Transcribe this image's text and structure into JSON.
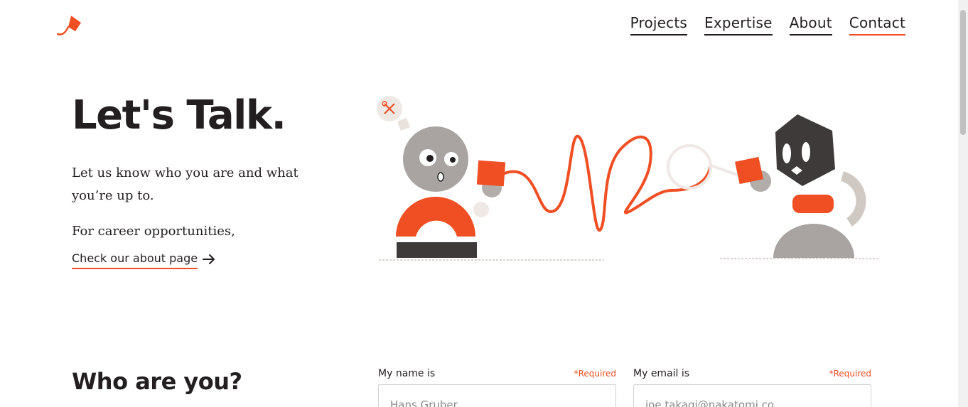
{
  "brand": {
    "logo_icon": "kite-logo-icon",
    "accent_color": "#f04e23"
  },
  "nav": [
    {
      "label": "Projects",
      "active": false
    },
    {
      "label": "Expertise",
      "active": false
    },
    {
      "label": "About",
      "active": false
    },
    {
      "label": "Contact",
      "active": true
    }
  ],
  "hero": {
    "title": "Let's Talk.",
    "intro": "Let us know who you are and what you’re up to.",
    "career_text": "For career opportunities,",
    "about_link": "Check our about page"
  },
  "form": {
    "section_title": "Who are you?",
    "name_field": {
      "label": "My name is",
      "required": "*Required",
      "placeholder": "Hans Gruber"
    },
    "email_field": {
      "label": "My email is",
      "required": "*Required",
      "placeholder": "joe.takagi@nakatomi.co"
    }
  }
}
